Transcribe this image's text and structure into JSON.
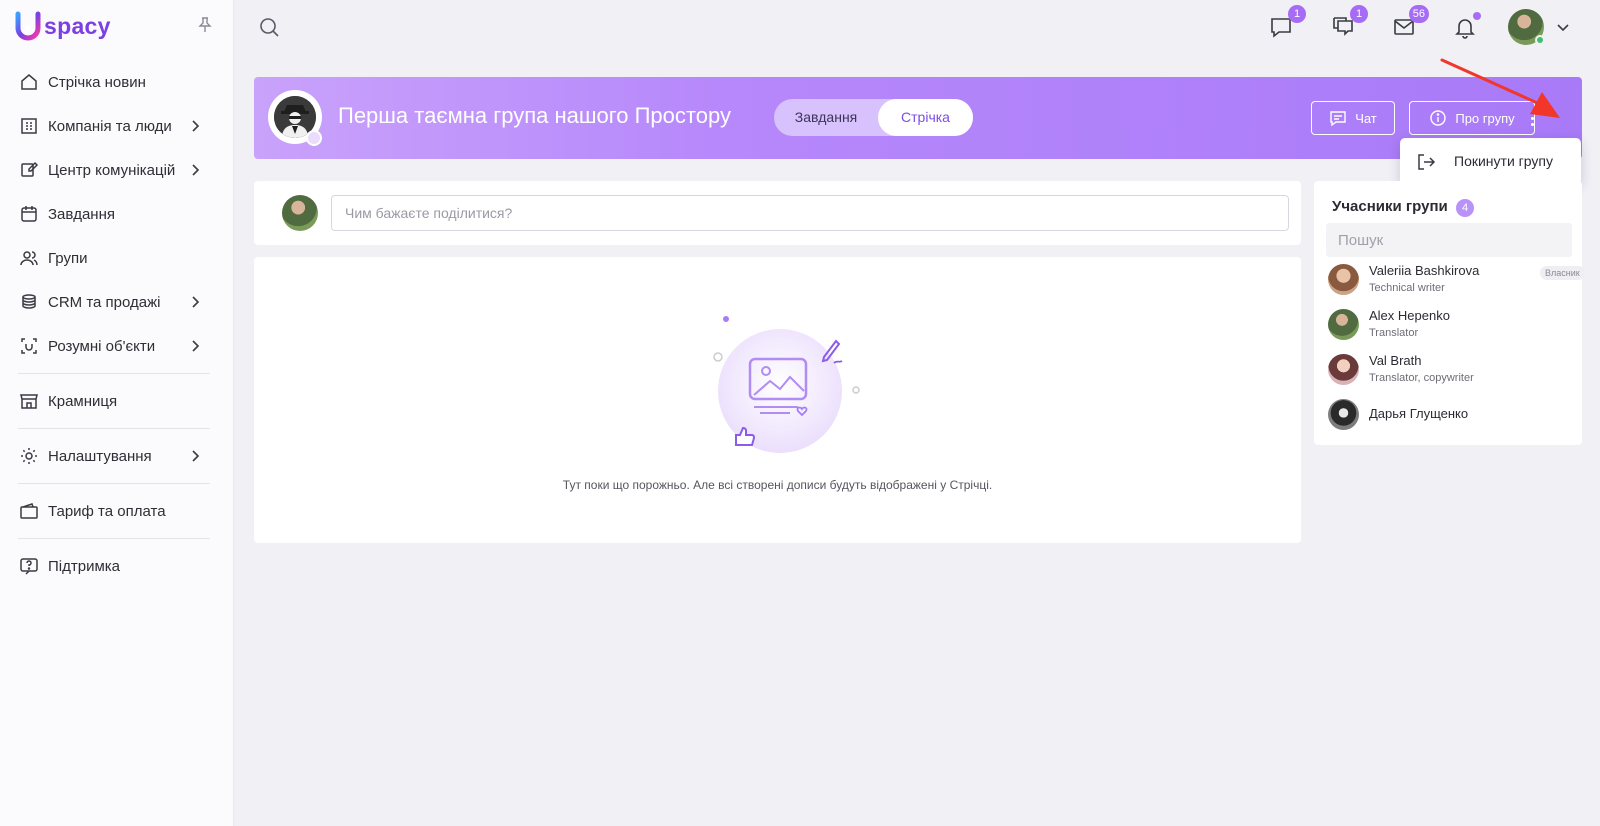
{
  "app": {
    "logo_text": "spacy",
    "brand_color": "#7b3fe4",
    "accent_color": "#a97af8"
  },
  "sidebar": {
    "items": [
      {
        "label": "Стрічка новин",
        "icon": "home-icon",
        "has_submenu": false
      },
      {
        "label": "Компанія та люди",
        "icon": "building-icon",
        "has_submenu": true
      },
      {
        "label": "Центр комунікацій",
        "icon": "chat-edit-icon",
        "has_submenu": true
      },
      {
        "label": "Завдання",
        "icon": "calendar-icon",
        "has_submenu": false
      },
      {
        "label": "Групи",
        "icon": "users-icon",
        "has_submenu": false
      },
      {
        "label": "CRM та продажі",
        "icon": "coins-icon",
        "has_submenu": true
      },
      {
        "label": "Розумні об'єкти",
        "icon": "smart-object-icon",
        "has_submenu": true
      },
      {
        "label": "Крамниця",
        "icon": "store-icon",
        "has_submenu": false
      },
      {
        "label": "Налаштування",
        "icon": "gear-icon",
        "has_submenu": true
      },
      {
        "label": "Тариф та оплата",
        "icon": "wallet-icon",
        "has_submenu": false
      },
      {
        "label": "Підтримка",
        "icon": "help-icon",
        "has_submenu": false
      }
    ]
  },
  "topbar": {
    "chat_badge": "1",
    "comments_badge": "1",
    "mail_badge": "56",
    "online_color": "#3cc26c"
  },
  "group": {
    "title": "Перша таємна група нашого Простору",
    "tabs": [
      {
        "label": "Завдання",
        "active": false
      },
      {
        "label": "Стрічка",
        "active": true
      }
    ],
    "chat_label": "Чат",
    "about_label": "Про групу",
    "menu": {
      "leave_label": "Покинути групу"
    }
  },
  "composer": {
    "placeholder": "Чим бажаєте поділитися?"
  },
  "feed": {
    "empty_text": "Тут поки що порожньо. Але всі створені дописи будуть відображені у Стрічці."
  },
  "members": {
    "title": "Учасники групи",
    "count": "4",
    "search_placeholder": "Пошук",
    "list": [
      {
        "name": "Valeriia Bashkirova",
        "role": "Technical writer",
        "owner_label": "Власник"
      },
      {
        "name": "Alex Hepenko",
        "role": "Translator",
        "owner_label": ""
      },
      {
        "name": "Val Brath",
        "role": "Translator, copywriter",
        "owner_label": ""
      },
      {
        "name": "Дарья Глущенко",
        "role": "",
        "owner_label": ""
      }
    ]
  }
}
